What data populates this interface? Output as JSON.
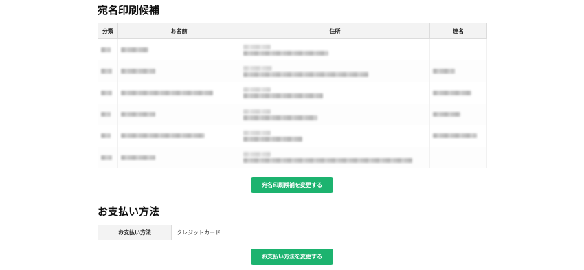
{
  "recipients": {
    "title": "宛名印刷候補",
    "columns": {
      "category": "分類",
      "name": "お名前",
      "address": "住所",
      "joint_name": "連名"
    },
    "rows_note": "blurred",
    "change_button": "宛名印刷候補を変更する"
  },
  "payment": {
    "title": "お支払い方法",
    "label": "お支払い方法",
    "value": "クレジットカード",
    "change_button": "お支払い方法を変更する"
  },
  "colors": {
    "accent": "#1cb36f",
    "header_bg": "#f3f3f3",
    "border": "#dcdcdc"
  }
}
